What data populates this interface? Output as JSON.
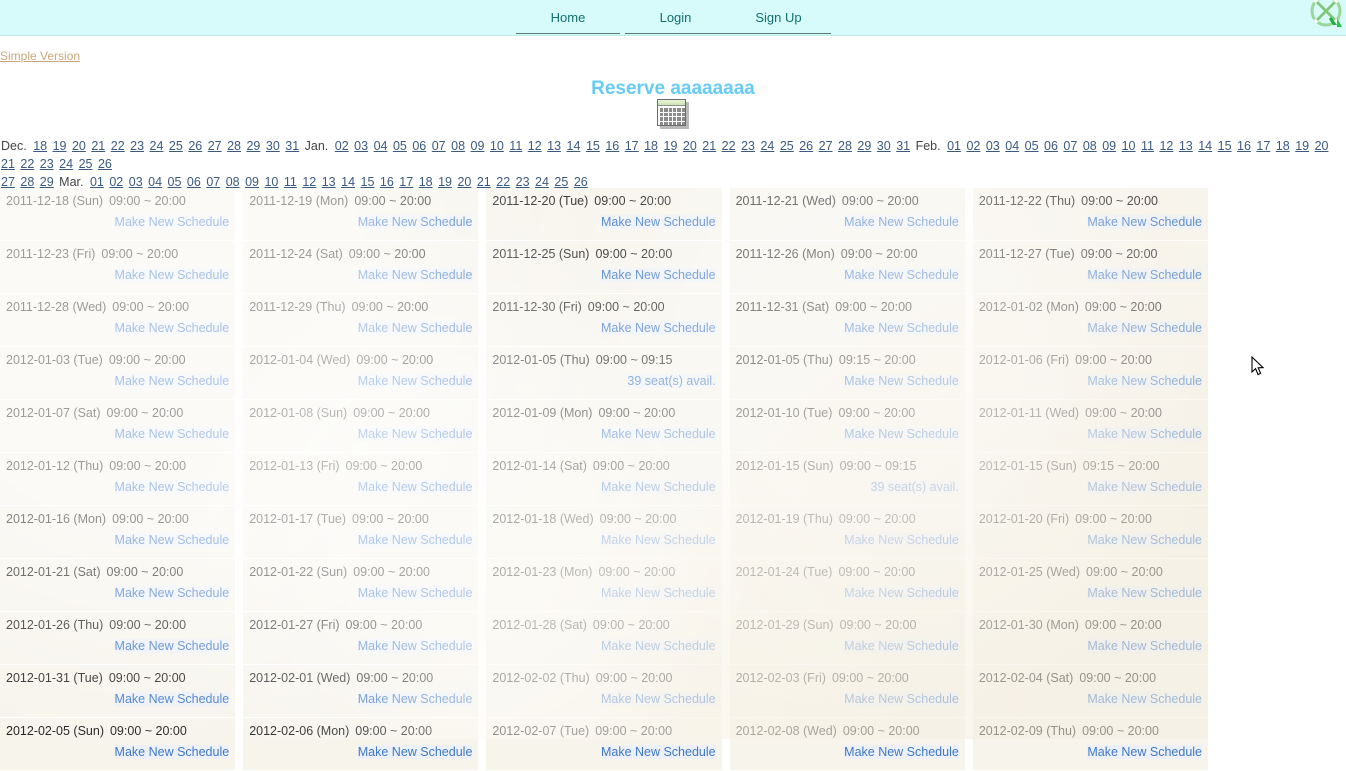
{
  "nav": {
    "tabs": [
      {
        "label": "Home",
        "name": "nav-tab-home"
      },
      {
        "label": "Login",
        "name": "nav-tab-login"
      },
      {
        "label": "Sign Up",
        "name": "nav-tab-signup"
      }
    ],
    "logo_icon": "puzzle-logo-icon",
    "accent_bg": "#d7fbfb",
    "link_color": "#11706e"
  },
  "simple_version": {
    "label": "Simple Version",
    "color": "#c8a87a"
  },
  "page": {
    "title": "Reserve aaaaaaaa",
    "title_color": "#66ccf5",
    "icon": "calendar-icon"
  },
  "date_nav": {
    "rows": [
      [
        {
          "type": "month",
          "label": "Dec."
        },
        {
          "type": "day",
          "label": "18"
        },
        {
          "type": "day",
          "label": "19"
        },
        {
          "type": "day",
          "label": "20"
        },
        {
          "type": "day",
          "label": "21"
        },
        {
          "type": "day",
          "label": "22"
        },
        {
          "type": "day",
          "label": "23"
        },
        {
          "type": "day",
          "label": "24"
        },
        {
          "type": "day",
          "label": "25"
        },
        {
          "type": "day",
          "label": "26"
        },
        {
          "type": "day",
          "label": "27"
        },
        {
          "type": "day",
          "label": "28"
        },
        {
          "type": "day",
          "label": "29"
        },
        {
          "type": "day",
          "label": "30"
        },
        {
          "type": "day",
          "label": "31"
        },
        {
          "type": "month",
          "label": "Jan."
        },
        {
          "type": "day",
          "label": "02"
        },
        {
          "type": "day",
          "label": "03"
        },
        {
          "type": "day",
          "label": "04"
        },
        {
          "type": "day",
          "label": "05"
        },
        {
          "type": "day",
          "label": "06"
        },
        {
          "type": "day",
          "label": "07"
        },
        {
          "type": "day",
          "label": "08"
        },
        {
          "type": "day",
          "label": "09"
        },
        {
          "type": "day",
          "label": "10"
        },
        {
          "type": "day",
          "label": "11"
        },
        {
          "type": "day",
          "label": "12"
        },
        {
          "type": "day",
          "label": "13"
        },
        {
          "type": "day",
          "label": "14"
        },
        {
          "type": "day",
          "label": "15"
        },
        {
          "type": "day",
          "label": "16"
        },
        {
          "type": "day",
          "label": "17"
        },
        {
          "type": "day",
          "label": "18"
        },
        {
          "type": "day",
          "label": "19"
        },
        {
          "type": "day",
          "label": "20"
        },
        {
          "type": "day",
          "label": "21"
        },
        {
          "type": "day",
          "label": "22"
        },
        {
          "type": "day",
          "label": "23"
        },
        {
          "type": "day",
          "label": "24"
        },
        {
          "type": "day",
          "label": "25"
        },
        {
          "type": "day",
          "label": "26"
        },
        {
          "type": "day",
          "label": "27"
        },
        {
          "type": "day",
          "label": "28"
        },
        {
          "type": "day",
          "label": "29"
        },
        {
          "type": "day",
          "label": "30"
        },
        {
          "type": "day",
          "label": "31"
        },
        {
          "type": "month",
          "label": "Feb."
        },
        {
          "type": "day",
          "label": "01"
        },
        {
          "type": "day",
          "label": "02"
        },
        {
          "type": "day",
          "label": "03"
        },
        {
          "type": "day",
          "label": "04"
        },
        {
          "type": "day",
          "label": "05"
        },
        {
          "type": "day",
          "label": "06"
        },
        {
          "type": "day",
          "label": "07"
        },
        {
          "type": "day",
          "label": "08"
        },
        {
          "type": "day",
          "label": "09"
        },
        {
          "type": "day",
          "label": "10"
        },
        {
          "type": "day",
          "label": "11"
        },
        {
          "type": "day",
          "label": "12"
        },
        {
          "type": "day",
          "label": "13"
        },
        {
          "type": "day",
          "label": "14"
        },
        {
          "type": "day",
          "label": "15"
        },
        {
          "type": "day",
          "label": "16"
        },
        {
          "type": "day",
          "label": "17"
        },
        {
          "type": "day",
          "label": "18"
        },
        {
          "type": "day",
          "label": "19"
        },
        {
          "type": "day",
          "label": "20"
        },
        {
          "type": "day",
          "label": "21"
        },
        {
          "type": "day",
          "label": "22"
        },
        {
          "type": "day",
          "label": "23"
        },
        {
          "type": "day",
          "label": "24"
        },
        {
          "type": "day",
          "label": "25"
        },
        {
          "type": "day",
          "label": "26"
        }
      ],
      [
        {
          "type": "day",
          "label": "27"
        },
        {
          "type": "day",
          "label": "28"
        },
        {
          "type": "day",
          "label": "29"
        },
        {
          "type": "month",
          "label": "Mar."
        },
        {
          "type": "day",
          "label": "01"
        },
        {
          "type": "day",
          "label": "02"
        },
        {
          "type": "day",
          "label": "03"
        },
        {
          "type": "day",
          "label": "04"
        },
        {
          "type": "day",
          "label": "05"
        },
        {
          "type": "day",
          "label": "06"
        },
        {
          "type": "day",
          "label": "07"
        },
        {
          "type": "day",
          "label": "08"
        },
        {
          "type": "day",
          "label": "09"
        },
        {
          "type": "day",
          "label": "10"
        },
        {
          "type": "day",
          "label": "11"
        },
        {
          "type": "day",
          "label": "12"
        },
        {
          "type": "day",
          "label": "13"
        },
        {
          "type": "day",
          "label": "14"
        },
        {
          "type": "day",
          "label": "15"
        },
        {
          "type": "day",
          "label": "16"
        },
        {
          "type": "day",
          "label": "17"
        },
        {
          "type": "day",
          "label": "18"
        },
        {
          "type": "day",
          "label": "19"
        },
        {
          "type": "day",
          "label": "20"
        },
        {
          "type": "day",
          "label": "21"
        },
        {
          "type": "day",
          "label": "22"
        },
        {
          "type": "day",
          "label": "23"
        },
        {
          "type": "day",
          "label": "24"
        },
        {
          "type": "day",
          "label": "25"
        },
        {
          "type": "day",
          "label": "26"
        }
      ]
    ]
  },
  "schedule": {
    "action_label": "Make New Schedule",
    "columns": [
      {
        "cells": [
          {
            "date": "2011-12-18 (Sun)",
            "time": "09:00 ~ 20:00",
            "action": "Make New Schedule",
            "kind": "new"
          },
          {
            "date": "2011-12-23 (Fri)",
            "time": "09:00 ~ 20:00",
            "action": "Make New Schedule",
            "kind": "new"
          },
          {
            "date": "2011-12-28 (Wed)",
            "time": "09:00 ~ 20:00",
            "action": "Make New Schedule",
            "kind": "new"
          },
          {
            "date": "2012-01-03 (Tue)",
            "time": "09:00 ~ 20:00",
            "action": "Make New Schedule",
            "kind": "new"
          },
          {
            "date": "2012-01-07 (Sat)",
            "time": "09:00 ~ 20:00",
            "action": "Make New Schedule",
            "kind": "new"
          },
          {
            "date": "2012-01-12 (Thu)",
            "time": "09:00 ~ 20:00",
            "action": "Make New Schedule",
            "kind": "new"
          },
          {
            "date": "2012-01-16 (Mon)",
            "time": "09:00 ~ 20:00",
            "action": "Make New Schedule",
            "kind": "new"
          },
          {
            "date": "2012-01-21 (Sat)",
            "time": "09:00 ~ 20:00",
            "action": "Make New Schedule",
            "kind": "new"
          },
          {
            "date": "2012-01-26 (Thu)",
            "time": "09:00 ~ 20:00",
            "action": "Make New Schedule",
            "kind": "new"
          },
          {
            "date": "2012-01-31 (Tue)",
            "time": "09:00 ~ 20:00",
            "action": "Make New Schedule",
            "kind": "new"
          },
          {
            "date": "2012-02-05 (Sun)",
            "time": "09:00 ~ 20:00",
            "action": "Make New Schedule",
            "kind": "new"
          }
        ]
      },
      {
        "cells": [
          {
            "date": "2011-12-19 (Mon)",
            "time": "09:00 ~ 20:00",
            "action": "Make New Schedule",
            "kind": "new"
          },
          {
            "date": "2011-12-24 (Sat)",
            "time": "09:00 ~ 20:00",
            "action": "Make New Schedule",
            "kind": "new"
          },
          {
            "date": "2011-12-29 (Thu)",
            "time": "09:00 ~ 20:00",
            "action": "Make New Schedule",
            "kind": "new"
          },
          {
            "date": "2012-01-04 (Wed)",
            "time": "09:00 ~ 20:00",
            "action": "Make New Schedule",
            "kind": "new"
          },
          {
            "date": "2012-01-08 (Sun)",
            "time": "09:00 ~ 20:00",
            "action": "Make New Schedule",
            "kind": "new"
          },
          {
            "date": "2012-01-13 (Fri)",
            "time": "09:00 ~ 20:00",
            "action": "Make New Schedule",
            "kind": "new"
          },
          {
            "date": "2012-01-17 (Tue)",
            "time": "09:00 ~ 20:00",
            "action": "Make New Schedule",
            "kind": "new"
          },
          {
            "date": "2012-01-22 (Sun)",
            "time": "09:00 ~ 20:00",
            "action": "Make New Schedule",
            "kind": "new"
          },
          {
            "date": "2012-01-27 (Fri)",
            "time": "09:00 ~ 20:00",
            "action": "Make New Schedule",
            "kind": "new"
          },
          {
            "date": "2012-02-01 (Wed)",
            "time": "09:00 ~ 20:00",
            "action": "Make New Schedule",
            "kind": "new"
          },
          {
            "date": "2012-02-06 (Mon)",
            "time": "09:00 ~ 20:00",
            "action": "Make New Schedule",
            "kind": "new"
          }
        ]
      },
      {
        "cells": [
          {
            "date": "2011-12-20 (Tue)",
            "time": "09:00 ~ 20:00",
            "action": "Make New Schedule",
            "kind": "new"
          },
          {
            "date": "2011-12-25 (Sun)",
            "time": "09:00 ~ 20:00",
            "action": "Make New Schedule",
            "kind": "new"
          },
          {
            "date": "2011-12-30 (Fri)",
            "time": "09:00 ~ 20:00",
            "action": "Make New Schedule",
            "kind": "new"
          },
          {
            "date": "2012-01-05 (Thu)",
            "time": "09:00 ~ 09:15",
            "action": "39 seat(s) avail.",
            "kind": "seats"
          },
          {
            "date": "2012-01-09 (Mon)",
            "time": "09:00 ~ 20:00",
            "action": "Make New Schedule",
            "kind": "new"
          },
          {
            "date": "2012-01-14 (Sat)",
            "time": "09:00 ~ 20:00",
            "action": "Make New Schedule",
            "kind": "new"
          },
          {
            "date": "2012-01-18 (Wed)",
            "time": "09:00 ~ 20:00",
            "action": "Make New Schedule",
            "kind": "new"
          },
          {
            "date": "2012-01-23 (Mon)",
            "time": "09:00 ~ 20:00",
            "action": "Make New Schedule",
            "kind": "new"
          },
          {
            "date": "2012-01-28 (Sat)",
            "time": "09:00 ~ 20:00",
            "action": "Make New Schedule",
            "kind": "new"
          },
          {
            "date": "2012-02-02 (Thu)",
            "time": "09:00 ~ 20:00",
            "action": "Make New Schedule",
            "kind": "new"
          },
          {
            "date": "2012-02-07 (Tue)",
            "time": "09:00 ~ 20:00",
            "action": "Make New Schedule",
            "kind": "new"
          }
        ]
      },
      {
        "cells": [
          {
            "date": "2011-12-21 (Wed)",
            "time": "09:00 ~ 20:00",
            "action": "Make New Schedule",
            "kind": "new"
          },
          {
            "date": "2011-12-26 (Mon)",
            "time": "09:00 ~ 20:00",
            "action": "Make New Schedule",
            "kind": "new"
          },
          {
            "date": "2011-12-31 (Sat)",
            "time": "09:00 ~ 20:00",
            "action": "Make New Schedule",
            "kind": "new"
          },
          {
            "date": "2012-01-05 (Thu)",
            "time": "09:15 ~ 20:00",
            "action": "Make New Schedule",
            "kind": "new"
          },
          {
            "date": "2012-01-10 (Tue)",
            "time": "09:00 ~ 20:00",
            "action": "Make New Schedule",
            "kind": "new"
          },
          {
            "date": "2012-01-15 (Sun)",
            "time": "09:00 ~ 09:15",
            "action": "39 seat(s) avail.",
            "kind": "seats"
          },
          {
            "date": "2012-01-19 (Thu)",
            "time": "09:00 ~ 20:00",
            "action": "Make New Schedule",
            "kind": "new"
          },
          {
            "date": "2012-01-24 (Tue)",
            "time": "09:00 ~ 20:00",
            "action": "Make New Schedule",
            "kind": "new"
          },
          {
            "date": "2012-01-29 (Sun)",
            "time": "09:00 ~ 20:00",
            "action": "Make New Schedule",
            "kind": "new"
          },
          {
            "date": "2012-02-03 (Fri)",
            "time": "09:00 ~ 20:00",
            "action": "Make New Schedule",
            "kind": "new"
          },
          {
            "date": "2012-02-08 (Wed)",
            "time": "09:00 ~ 20:00",
            "action": "Make New Schedule",
            "kind": "new"
          }
        ]
      },
      {
        "cells": [
          {
            "date": "2011-12-22 (Thu)",
            "time": "09:00 ~ 20:00",
            "action": "Make New Schedule",
            "kind": "new"
          },
          {
            "date": "2011-12-27 (Tue)",
            "time": "09:00 ~ 20:00",
            "action": "Make New Schedule",
            "kind": "new"
          },
          {
            "date": "2012-01-02 (Mon)",
            "time": "09:00 ~ 20:00",
            "action": "Make New Schedule",
            "kind": "new"
          },
          {
            "date": "2012-01-06 (Fri)",
            "time": "09:00 ~ 20:00",
            "action": "Make New Schedule",
            "kind": "new"
          },
          {
            "date": "2012-01-11 (Wed)",
            "time": "09:00 ~ 20:00",
            "action": "Make New Schedule",
            "kind": "new"
          },
          {
            "date": "2012-01-15 (Sun)",
            "time": "09:15 ~ 20:00",
            "action": "Make New Schedule",
            "kind": "new"
          },
          {
            "date": "2012-01-20 (Fri)",
            "time": "09:00 ~ 20:00",
            "action": "Make New Schedule",
            "kind": "new"
          },
          {
            "date": "2012-01-25 (Wed)",
            "time": "09:00 ~ 20:00",
            "action": "Make New Schedule",
            "kind": "new"
          },
          {
            "date": "2012-01-30 (Mon)",
            "time": "09:00 ~ 20:00",
            "action": "Make New Schedule",
            "kind": "new"
          },
          {
            "date": "2012-02-04 (Sat)",
            "time": "09:00 ~ 20:00",
            "action": "Make New Schedule",
            "kind": "new"
          },
          {
            "date": "2012-02-09 (Thu)",
            "time": "09:00 ~ 20:00",
            "action": "Make New Schedule",
            "kind": "new"
          }
        ]
      }
    ]
  }
}
